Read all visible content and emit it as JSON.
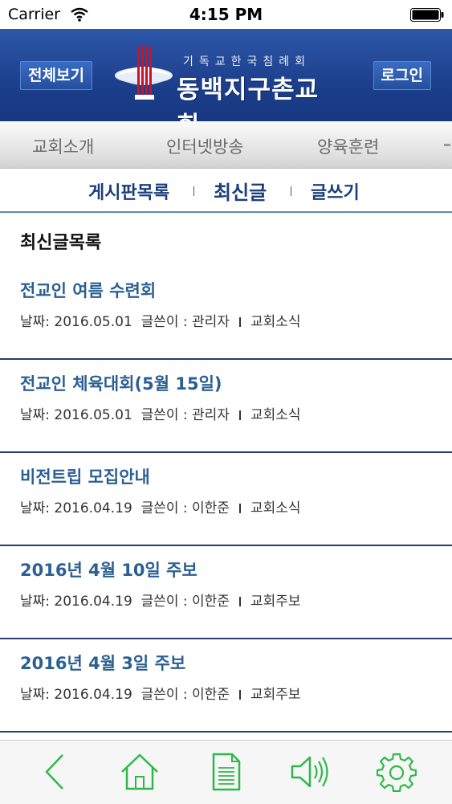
{
  "status_bar": {
    "carrier": "Carrier",
    "time": "4:15 PM"
  },
  "header": {
    "view_all_label": "전체보기",
    "login_label": "로그인",
    "logo_tagline": "기독교한국침례회",
    "logo_name": "동백지구촌교회"
  },
  "category_nav": {
    "items": [
      "교회소개",
      "인터넷방송",
      "양육훈련"
    ]
  },
  "sub_nav": {
    "tabs": [
      "게시판목록",
      "최신글",
      "글쓰기"
    ],
    "active": "최신글"
  },
  "list": {
    "title": "최신글목록",
    "date_label": "날짜:",
    "author_label": "글쓴이 :",
    "posts": [
      {
        "title": "전교인 여름 수련회",
        "date": "2016.05.01",
        "author": "관리자",
        "category": "교회소식"
      },
      {
        "title": "전교인 체육대회(5월 15일)",
        "date": "2016.05.01",
        "author": "관리자",
        "category": "교회소식"
      },
      {
        "title": "비전트립 모집안내",
        "date": "2016.04.19",
        "author": "이한준",
        "category": "교회소식"
      },
      {
        "title": "2016년 4월 10일 주보",
        "date": "2016.04.19",
        "author": "이한준",
        "category": "교회주보"
      },
      {
        "title": "2016년 4월 3일 주보",
        "date": "2016.04.19",
        "author": "이한준",
        "category": "교회주보"
      }
    ]
  },
  "tab_bar": {
    "icons": [
      "back-icon",
      "home-icon",
      "document-icon",
      "speaker-icon",
      "gear-icon"
    ],
    "color": "#2fb84a"
  },
  "colors": {
    "header_blue": "#1c3f8c",
    "post_title": "#2b5f93",
    "sub_nav_text": "#1c3f7a"
  }
}
